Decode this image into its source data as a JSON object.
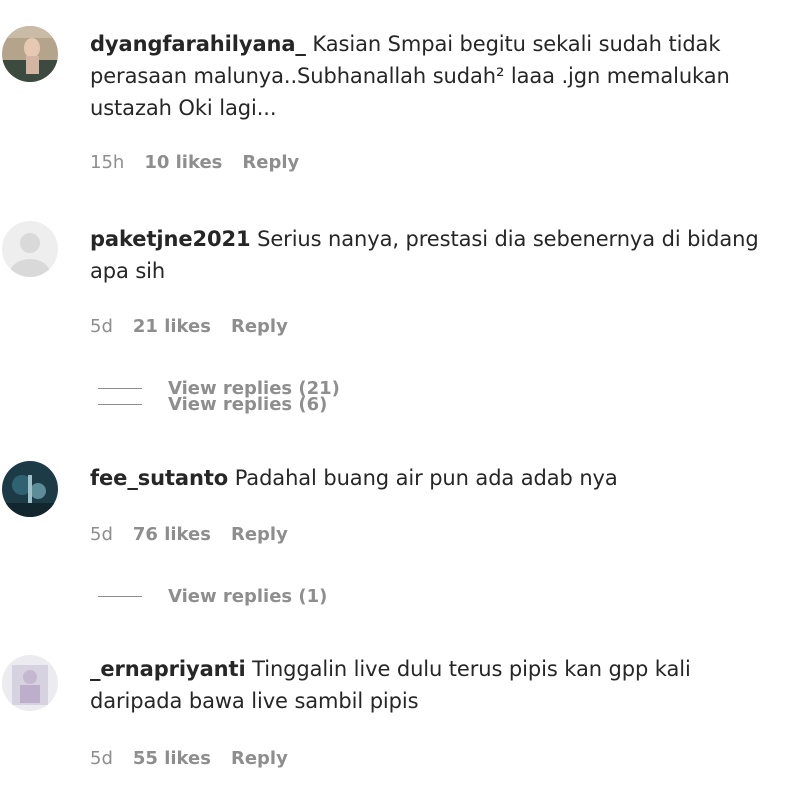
{
  "comments": [
    {
      "username": "dyangfarahilyana_",
      "text": "Kasian Smpai begitu sekali sudah tidak perasaan malunya..Subhanallah sudah² laaa .jgn memalukan ustazah Oki lagi...",
      "time": "15h",
      "likes": "10 likes",
      "reply": "Reply",
      "avatar_icon": "user-avatar-photo"
    },
    {
      "username": "paketjne2021",
      "text": "Serius nanya, prestasi dia sebenernya di bidang apa sih",
      "time": "5d",
      "likes": "21 likes",
      "reply": "Reply",
      "avatar_icon": "default-avatar-icon",
      "view_replies": [
        "View replies (21)",
        "View replies (6)"
      ]
    },
    {
      "username": "fee_sutanto",
      "text": "Padahal buang air pun ada adab nya",
      "time": "5d",
      "likes": "76 likes",
      "reply": "Reply",
      "avatar_icon": "user-avatar-photo",
      "view_replies": [
        "View replies (1)"
      ]
    },
    {
      "username": "_ernapriyanti",
      "text": "Tinggalin live dulu terus pipis kan gpp kali daripada bawa live sambil pipis",
      "time": "5d",
      "likes": "55 likes",
      "reply": "Reply",
      "avatar_icon": "user-avatar-photo"
    }
  ],
  "colors": {
    "text": "#262626",
    "secondary": "#8e8e8e",
    "background": "#ffffff"
  }
}
